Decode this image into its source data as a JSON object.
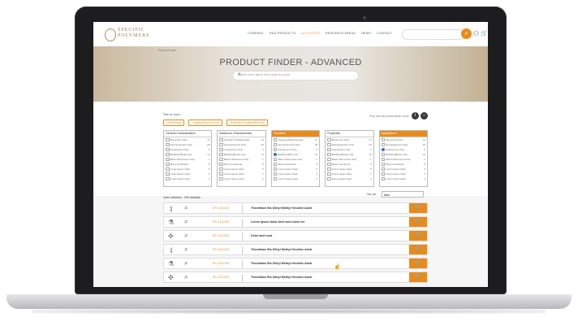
{
  "header": {
    "logo_line1": "SPECIFIC",
    "logo_line2": "POLYMERS",
    "nav": [
      "COMPANY",
      "R&D PRODUCTS",
      "ACTIVITIES",
      "RESEARCH AREAS",
      "NEWS",
      "CONTACT"
    ],
    "active_nav_index": 2,
    "cart_icon": "cart-icon",
    "user_icon": "user-icon"
  },
  "hero": {
    "breadcrumb": "Product Finder",
    "title": "PRODUCT FINDER - ADVANCED",
    "search_placeholder": "Search lorem ipsum dolor amet by words"
  },
  "filters": {
    "label": "Filter en cours :",
    "chips": [
      "Lorem ipsum",
      "Oxygene Based Groups",
      "Molecular & pentamethyl urea"
    ],
    "view_label": "Pour view the product finder count",
    "columns": [
      {
        "title": "General Characteristics",
        "orange": false,
        "items": [
          {
            "l": "Monomers Only",
            "c": "14"
          },
          {
            "l": "Homopolymers Only",
            "c": "28"
          },
          {
            "l": "Copolymers Only",
            "c": "6"
          },
          {
            "l": "Building Blocks only",
            "c": "19"
          },
          {
            "l": "Macro Monomers Only",
            "c": "1"
          },
          {
            "l": "Mono Functional",
            "c": "8"
          },
          {
            "l": "Lorem ipsum dolor",
            "c": "5"
          },
          {
            "l": "Lorem ipsum dolor",
            "c": "2"
          },
          {
            "l": "Lorem ipsum dolor",
            "c": "3"
          }
        ]
      },
      {
        "title": "Backbone Characteristics",
        "orange": false,
        "items": [
          {
            "l": "Acrylate & Methacrylate",
            "c": "14"
          },
          {
            "l": "Homopolymers Only",
            "c": "28"
          },
          {
            "l": "Copolymers Only",
            "c": "6"
          },
          {
            "l": "Building Blocks only",
            "c": "19"
          },
          {
            "l": "Macro Monomers Only",
            "c": "1"
          },
          {
            "l": "Mono Functional",
            "c": "8"
          },
          {
            "l": "Lorem ipsum dolor",
            "c": "5"
          },
          {
            "l": "Lorem ipsum dolor",
            "c": "2"
          },
          {
            "l": "Lorem ipsum dolor",
            "c": "3"
          }
        ]
      },
      {
        "title": "Functions",
        "orange": true,
        "items": [
          {
            "l": "Oxygene Based groups",
            "c": "14"
          },
          {
            "l": "Homopolymers Only",
            "c": "28"
          },
          {
            "l": "Copolymers Only",
            "c": "6"
          },
          {
            "l": "Building Block only",
            "c": "19",
            "on": true
          },
          {
            "l": "Macro Monomers Only",
            "c": "1"
          },
          {
            "l": "Mono Functional",
            "c": "8"
          },
          {
            "l": "Lorem ipsum dolor",
            "c": "5"
          },
          {
            "l": "Lorem ipsum dolor",
            "c": "2"
          },
          {
            "l": "Lorem ipsum dolor",
            "c": "3"
          }
        ]
      },
      {
        "title": "Properties",
        "orange": false,
        "items": [
          {
            "l": "Monomers Only",
            "c": "14"
          },
          {
            "l": "Homopolymers Only",
            "c": "28"
          },
          {
            "l": "Copolymers Only",
            "c": "6"
          },
          {
            "l": "Building Blocks only",
            "c": "19"
          },
          {
            "l": "Macro Monomers Only",
            "c": "1"
          },
          {
            "l": "Mono Functional",
            "c": "8"
          },
          {
            "l": "Lorem ipsum dolor",
            "c": "5"
          },
          {
            "l": "Lorem ipsum dolor",
            "c": "2"
          },
          {
            "l": "Lorem ipsum dolor",
            "c": "3"
          }
        ]
      },
      {
        "title": "Applications",
        "orange": true,
        "items": [
          {
            "l": "Monomers Only",
            "c": "14"
          },
          {
            "l": "Homopolymers Only",
            "c": "28"
          },
          {
            "l": "Copolymers Only",
            "c": "6",
            "on": true
          },
          {
            "l": "Building Blocks only",
            "c": "19"
          },
          {
            "l": "Macro Monomers Only",
            "c": "1"
          },
          {
            "l": "Mono Functional",
            "c": "8"
          },
          {
            "l": "Lorem ipsum dolor",
            "c": "5"
          },
          {
            "l": "Lorem ipsum dolor",
            "c": "2"
          },
          {
            "l": "Lorem ipsum dolor",
            "c": "3"
          }
        ]
      }
    ]
  },
  "results": {
    "label": "Votre sélection : 209 résultats",
    "sort_label": "Trier par",
    "sort_value": "Nom",
    "rows": [
      {
        "icon": "⺦",
        "ref": "SP-3-04-002",
        "name": "Thioethane Bis Dithyl Methyl Hexoline Azide"
      },
      {
        "icon": "⚗",
        "ref": "SP-3-04-002",
        "name": "Lorem ipsum dolor abet sout lorem ivo"
      },
      {
        "icon": "✣",
        "ref": "SP-3-04-002",
        "name": "Dolor abet sout"
      },
      {
        "icon": "⺦",
        "ref": "SP-3-04-002",
        "name": "Thioethane Bis Dithyl Methyl Hexoline Azide"
      },
      {
        "icon": "⚗",
        "ref": "SP-3-04-002",
        "name": "Thioethane Bis Dithyl Methyl Hexoline Azide"
      },
      {
        "icon": "✣",
        "ref": "SP-3-04-002",
        "name": "Thioethane Bis Dithyl Methyl Hexoline Azide"
      }
    ]
  },
  "colors": {
    "accent": "#e98b1b",
    "blue": "#3a6fc4"
  }
}
